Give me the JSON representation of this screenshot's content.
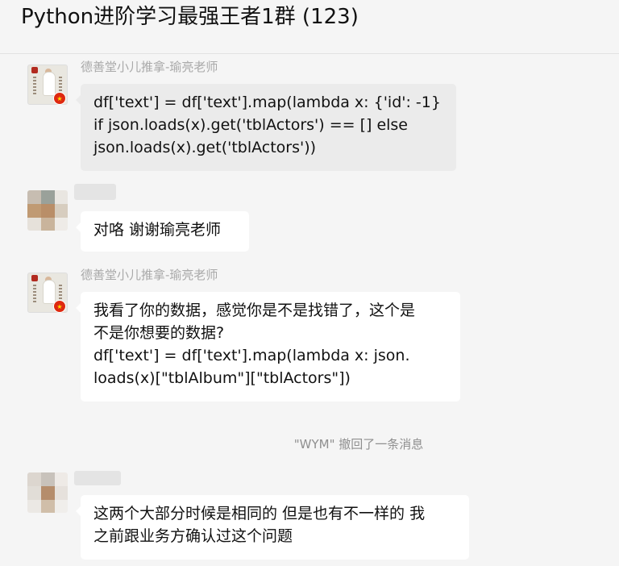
{
  "header": {
    "title": "Python进阶学习最强王者1群 (123)",
    "more_glyph": "···"
  },
  "messages": [
    {
      "sender": "德善堂小儿推拿-瑜亮老师",
      "lines": [
        "df['text'] = df['text'].map(lambda x: {'id': -1}",
        "if json.loads(x).get('tblActors') == [] else",
        "json.loads(x).get('tblActors'))"
      ]
    },
    {
      "sender": "",
      "lines": [
        "对咯  谢谢瑜亮老师"
      ]
    },
    {
      "sender": "德善堂小儿推拿-瑜亮老师",
      "lines": [
        "我看了你的数据，感觉你是不是找错了，这个是",
        "不是你想要的数据?",
        "df['text'] = df['text'].map(lambda x: json.",
        "loads(x)[\"tblAlbum\"][\"tblActors\"])"
      ]
    },
    {
      "sender": "",
      "lines": [
        "这两个大部分时候是相同的 但是也有不一样的 我",
        "之前跟业务方确认过这个问题"
      ]
    }
  ],
  "system_notice": "\"WYM\" 撤回了一条消息",
  "colors": {
    "background": "#f5f5f5",
    "bubble_white": "#ffffff",
    "bubble_grey": "#ebebeb",
    "sender_name": "#a9a9a9",
    "notice": "#8f8f8f",
    "flag_red": "#de2910"
  }
}
